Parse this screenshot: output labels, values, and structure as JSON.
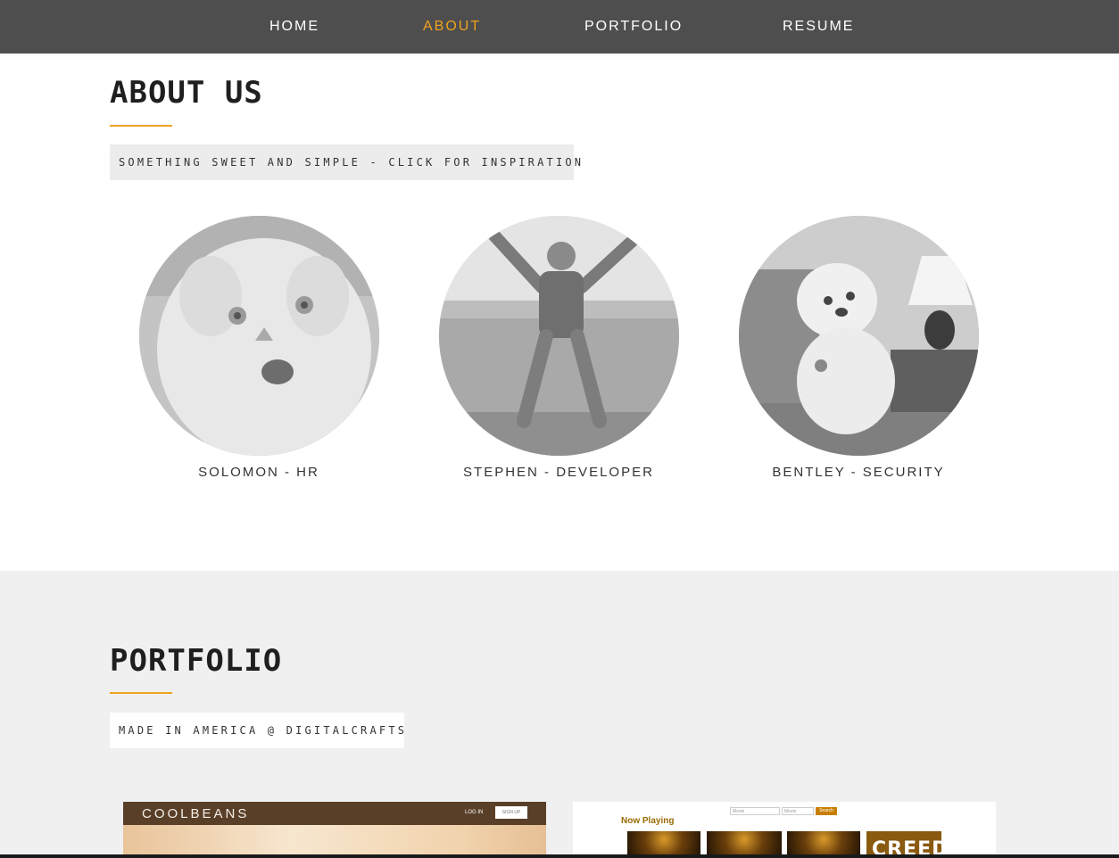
{
  "nav": {
    "items": [
      {
        "label": "HOME",
        "active": false
      },
      {
        "label": "ABOUT",
        "active": true
      },
      {
        "label": "PORTFOLIO",
        "active": false
      },
      {
        "label": "RESUME",
        "active": false
      }
    ]
  },
  "about": {
    "title": "ABOUT US",
    "tagline": "SOMETHING SWEET AND SIMPLE - CLICK FOR INSPIRATION",
    "members": [
      {
        "caption": "SOLOMON - HR"
      },
      {
        "caption": "STEPHEN - DEVELOPER"
      },
      {
        "caption": "BENTLEY - SECURITY"
      }
    ]
  },
  "portfolio": {
    "title": "PORTFOLIO",
    "tagline": "MADE IN AMERICA @ DIGITALCRAFTS",
    "projects": [
      {
        "logo": "COOLBEANS",
        "login": "LOG IN",
        "signup": "SIGN UP"
      },
      {
        "heading": "Now Playing",
        "search_placeholder_1": "Movie",
        "search_placeholder_2": "Movie",
        "search_button": "Search",
        "poster_text": "CREED"
      }
    ]
  },
  "colors": {
    "nav_bg": "#4e4e4e",
    "accent": "#f0a21e",
    "section_bg": "#f0f0f0",
    "tag_bg": "#ececec"
  }
}
